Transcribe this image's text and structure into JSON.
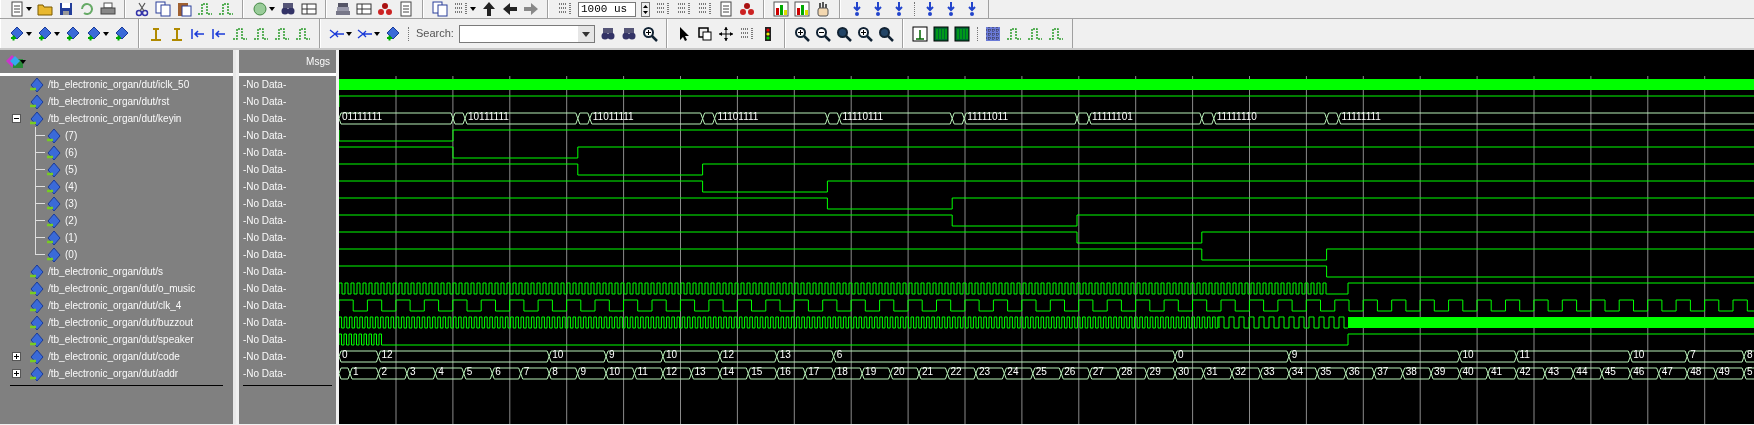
{
  "toolbar": {
    "time_field": {
      "value": "1000 us"
    },
    "search": {
      "label": "Search:"
    }
  },
  "wave": {
    "msgs_header": "Msgs",
    "signals": [
      {
        "name": "/tb_electronic_organ/dut/iclk_50",
        "msg": "-No Data-",
        "kind": "fastclock"
      },
      {
        "name": "/tb_electronic_organ/dut/rst",
        "msg": "-No Data-",
        "kind": "high"
      },
      {
        "name": "/tb_electronic_organ/dut/keyin",
        "msg": "-No Data-",
        "kind": "keybus",
        "expanded": true,
        "values": [
          "01111111",
          "10111111",
          "11011111",
          "11101111",
          "11110111",
          "11111011",
          "11111101",
          "11111110",
          "11111111"
        ],
        "children": [
          {
            "name": "(7)",
            "msg": "-No Data-",
            "kind": "bit"
          },
          {
            "name": "(6)",
            "msg": "-No Data-",
            "kind": "bit"
          },
          {
            "name": "(5)",
            "msg": "-No Data-",
            "kind": "bit"
          },
          {
            "name": "(4)",
            "msg": "-No Data-",
            "kind": "bit"
          },
          {
            "name": "(3)",
            "msg": "-No Data-",
            "kind": "bit"
          },
          {
            "name": "(2)",
            "msg": "-No Data-",
            "kind": "bit"
          },
          {
            "name": "(1)",
            "msg": "-No Data-",
            "kind": "bit"
          },
          {
            "name": "(0)",
            "msg": "-No Data-",
            "kind": "bit"
          }
        ]
      },
      {
        "name": "/tb_electronic_organ/dut/s",
        "msg": "-No Data-",
        "kind": "stepdown"
      },
      {
        "name": "/tb_electronic_organ/dut/o_music",
        "msg": "-No Data-",
        "kind": "burst"
      },
      {
        "name": "/tb_electronic_organ/dut/clk_4",
        "msg": "-No Data-",
        "kind": "clock"
      },
      {
        "name": "/tb_electronic_organ/dut/buzzout",
        "msg": "-No Data-",
        "kind": "dense"
      },
      {
        "name": "/tb_electronic_organ/dut/speaker",
        "msg": "-No Data-",
        "kind": "shortburst"
      },
      {
        "name": "/tb_electronic_organ/dut/code",
        "msg": "-No Data-",
        "kind": "codebus",
        "expanded": false,
        "values": [
          "0",
          "12",
          "10",
          "9",
          "10",
          "12",
          "13",
          "6",
          "0",
          "9",
          "10",
          "11",
          "10",
          "7",
          "8"
        ]
      },
      {
        "name": "/tb_electronic_organ/dut/addr",
        "msg": "-No Data-",
        "kind": "countbus",
        "expanded": false,
        "values": [
          "1",
          "2",
          "3",
          "4",
          "5",
          "6",
          "7",
          "8",
          "9",
          "10",
          "11",
          "12",
          "13",
          "14",
          "15",
          "16",
          "17",
          "18",
          "19",
          "20",
          "21",
          "22",
          "23",
          "24",
          "25",
          "26",
          "27",
          "28",
          "29",
          "30",
          "31",
          "32",
          "33",
          "34",
          "35",
          "36",
          "37",
          "38",
          "39",
          "40",
          "41",
          "42",
          "43",
          "44",
          "45",
          "46",
          "47",
          "48",
          "49",
          "5"
        ]
      }
    ]
  }
}
